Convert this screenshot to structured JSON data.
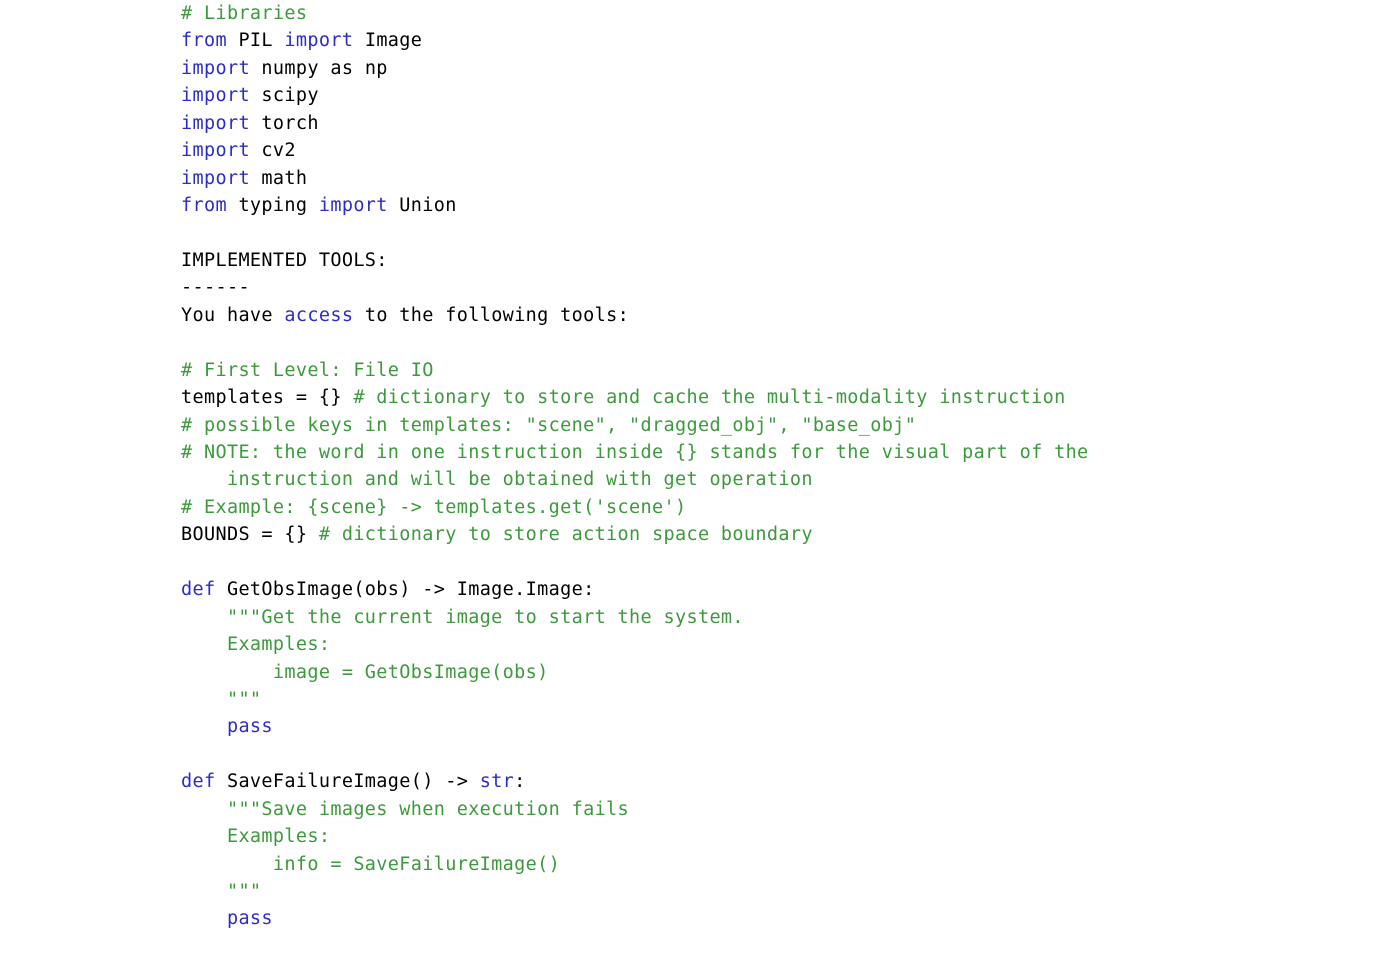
{
  "document": {
    "kind": "python-code-listing",
    "title": "IMPLEMENTED TOOLS",
    "background_color": "#ffffff"
  },
  "colors": {
    "keyword": "#2c2cc8",
    "comment": "#3c9a3c",
    "string": "#3c9a3c",
    "plain": "#000000",
    "background": "#ffffff"
  },
  "code": {
    "lines": [
      {
        "id": "l01",
        "text": "# Libraries",
        "tokens": [
          {
            "t": "# Libraries",
            "c": "cm"
          }
        ]
      },
      {
        "id": "l02",
        "text": "from PIL import Image",
        "tokens": [
          {
            "t": "from",
            "c": "kw"
          },
          {
            "t": " PIL ",
            "c": "pl"
          },
          {
            "t": "import",
            "c": "kw"
          },
          {
            "t": " Image",
            "c": "pl"
          }
        ]
      },
      {
        "id": "l03",
        "text": "import numpy as np",
        "tokens": [
          {
            "t": "import",
            "c": "kw"
          },
          {
            "t": " numpy as np",
            "c": "pl"
          }
        ]
      },
      {
        "id": "l04",
        "text": "import scipy",
        "tokens": [
          {
            "t": "import",
            "c": "kw"
          },
          {
            "t": " scipy",
            "c": "pl"
          }
        ]
      },
      {
        "id": "l05",
        "text": "import torch",
        "tokens": [
          {
            "t": "import",
            "c": "kw"
          },
          {
            "t": " torch",
            "c": "pl"
          }
        ]
      },
      {
        "id": "l06",
        "text": "import cv2",
        "tokens": [
          {
            "t": "import",
            "c": "kw"
          },
          {
            "t": " cv2",
            "c": "pl"
          }
        ]
      },
      {
        "id": "l07",
        "text": "import math",
        "tokens": [
          {
            "t": "import",
            "c": "kw"
          },
          {
            "t": " math",
            "c": "pl"
          }
        ]
      },
      {
        "id": "l08",
        "text": "from typing import Union",
        "tokens": [
          {
            "t": "from",
            "c": "kw"
          },
          {
            "t": " typing ",
            "c": "pl"
          },
          {
            "t": "import",
            "c": "kw"
          },
          {
            "t": " Union",
            "c": "pl"
          }
        ]
      },
      {
        "id": "l09",
        "text": "",
        "tokens": []
      },
      {
        "id": "l10",
        "text": "IMPLEMENTED TOOLS:",
        "tokens": [
          {
            "t": "IMPLEMENTED TOOLS:",
            "c": "pl"
          }
        ]
      },
      {
        "id": "l11",
        "text": "------",
        "tokens": [
          {
            "t": "------",
            "c": "pl"
          }
        ]
      },
      {
        "id": "l12",
        "text": "You have access to the following tools:",
        "tokens": [
          {
            "t": "You have ",
            "c": "pl"
          },
          {
            "t": "access",
            "c": "kw"
          },
          {
            "t": " to the following tools:",
            "c": "pl"
          }
        ]
      },
      {
        "id": "l13",
        "text": "",
        "tokens": []
      },
      {
        "id": "l14",
        "text": "# First Level: File IO",
        "tokens": [
          {
            "t": "# First Level: File IO",
            "c": "cm"
          }
        ]
      },
      {
        "id": "l15",
        "text": "templates = {} # dictionary to store and cache the multi-modality instruction",
        "tokens": [
          {
            "t": "templates = {} ",
            "c": "pl"
          },
          {
            "t": "# dictionary to store and cache the multi-modality instruction",
            "c": "cm"
          }
        ]
      },
      {
        "id": "l16",
        "text": "# possible keys in templates: \"scene\", \"dragged_obj\", \"base_obj\"",
        "tokens": [
          {
            "t": "# possible keys in templates: \"scene\", \"dragged_obj\", \"base_obj\"",
            "c": "cm"
          }
        ]
      },
      {
        "id": "l17",
        "text": "# NOTE: the word in one instruction inside {} stands for the visual part of the",
        "tokens": [
          {
            "t": "# NOTE: the word in one instruction inside {} stands for the visual part of the",
            "c": "cm"
          }
        ]
      },
      {
        "id": "l18",
        "text": "    instruction and will be obtained with get operation",
        "tokens": [
          {
            "t": "    instruction and will be obtained with get operation",
            "c": "cm"
          }
        ]
      },
      {
        "id": "l19",
        "text": "# Example: {scene} -> templates.get('scene')",
        "tokens": [
          {
            "t": "# Example: {scene} -> templates.get('scene')",
            "c": "cm"
          }
        ]
      },
      {
        "id": "l20",
        "text": "BOUNDS = {} # dictionary to store action space boundary",
        "tokens": [
          {
            "t": "BOUNDS = {} ",
            "c": "pl"
          },
          {
            "t": "# dictionary to store action space boundary",
            "c": "cm"
          }
        ]
      },
      {
        "id": "l21",
        "text": "",
        "tokens": []
      },
      {
        "id": "l22",
        "text": "def GetObsImage(obs) -> Image.Image:",
        "tokens": [
          {
            "t": "def",
            "c": "kw"
          },
          {
            "t": " GetObsImage(obs) -> Image.Image:",
            "c": "pl"
          }
        ]
      },
      {
        "id": "l23",
        "text": "    \"\"\"Get the current image to start the system.",
        "tokens": [
          {
            "t": "    \"\"\"Get the current image to start the system.",
            "c": "st"
          }
        ]
      },
      {
        "id": "l24",
        "text": "    Examples:",
        "tokens": [
          {
            "t": "    Examples:",
            "c": "st"
          }
        ]
      },
      {
        "id": "l25",
        "text": "        image = GetObsImage(obs)",
        "tokens": [
          {
            "t": "        image = GetObsImage(obs)",
            "c": "st"
          }
        ]
      },
      {
        "id": "l26",
        "text": "    \"\"\"",
        "tokens": [
          {
            "t": "    \"\"\"",
            "c": "st"
          }
        ]
      },
      {
        "id": "l27",
        "text": "    pass",
        "tokens": [
          {
            "t": "    ",
            "c": "pl"
          },
          {
            "t": "pass",
            "c": "kw"
          }
        ]
      },
      {
        "id": "l28",
        "text": "",
        "tokens": []
      },
      {
        "id": "l29",
        "text": "def SaveFailureImage() -> str:",
        "tokens": [
          {
            "t": "def",
            "c": "kw"
          },
          {
            "t": " SaveFailureImage() -> ",
            "c": "pl"
          },
          {
            "t": "str",
            "c": "kw"
          },
          {
            "t": ":",
            "c": "pl"
          }
        ]
      },
      {
        "id": "l30",
        "text": "    \"\"\"Save images when execution fails",
        "tokens": [
          {
            "t": "    \"\"\"Save images when execution fails",
            "c": "st"
          }
        ]
      },
      {
        "id": "l31",
        "text": "    Examples:",
        "tokens": [
          {
            "t": "    Examples:",
            "c": "st"
          }
        ]
      },
      {
        "id": "l32",
        "text": "        info = SaveFailureImage()",
        "tokens": [
          {
            "t": "        info = SaveFailureImage()",
            "c": "st"
          }
        ]
      },
      {
        "id": "l33",
        "text": "    \"\"\"",
        "tokens": [
          {
            "t": "    \"\"\"",
            "c": "st"
          }
        ]
      },
      {
        "id": "l34",
        "text": "    pass",
        "tokens": [
          {
            "t": "    ",
            "c": "pl"
          },
          {
            "t": "pass",
            "c": "kw"
          }
        ]
      }
    ]
  }
}
